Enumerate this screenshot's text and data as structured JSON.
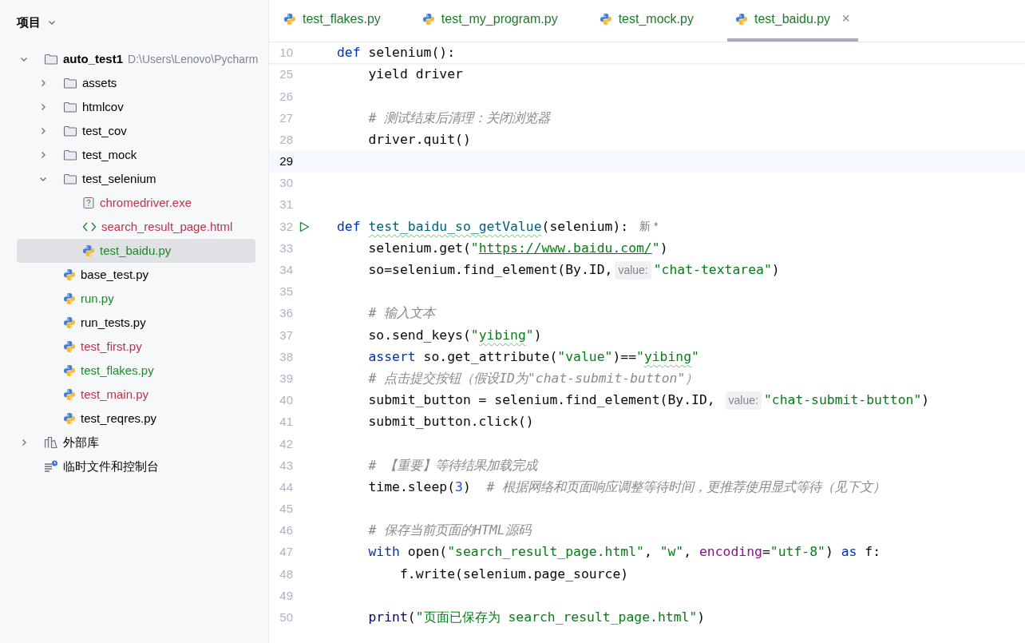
{
  "sidebar": {
    "title": "项目",
    "tree": [
      {
        "name": "auto_test1",
        "kind": "folder",
        "bold": true,
        "path": "D:\\Users\\Lenovo\\Pycharm",
        "expanded": true,
        "color": "#000000",
        "selected": false,
        "children": [
          {
            "name": "assets",
            "kind": "folder",
            "expanded": false,
            "color": "#000000",
            "selected": false
          },
          {
            "name": "htmlcov",
            "kind": "folder",
            "expanded": false,
            "color": "#000000",
            "selected": false
          },
          {
            "name": "test_cov",
            "kind": "folder",
            "expanded": false,
            "color": "#000000",
            "selected": false
          },
          {
            "name": "test_mock",
            "kind": "folder",
            "expanded": false,
            "color": "#000000",
            "selected": false
          },
          {
            "name": "test_selenium",
            "kind": "folder",
            "expanded": true,
            "color": "#000000",
            "selected": false,
            "children": [
              {
                "name": "chromedriver.exe",
                "kind": "unknown",
                "color": "#b8354c",
                "selected": false
              },
              {
                "name": "search_result_page.html",
                "kind": "html",
                "color": "#b8354c",
                "selected": false
              },
              {
                "name": "test_baidu.py",
                "kind": "python",
                "color": "#1e8a28",
                "selected": true
              }
            ]
          },
          {
            "name": "base_test.py",
            "kind": "python",
            "color": "#000000",
            "selected": false
          },
          {
            "name": "run.py",
            "kind": "python",
            "color": "#1e8a28",
            "selected": false
          },
          {
            "name": "run_tests.py",
            "kind": "python",
            "color": "#000000",
            "selected": false
          },
          {
            "name": "test_first.py",
            "kind": "python",
            "color": "#b8354c",
            "selected": false
          },
          {
            "name": "test_flakes.py",
            "kind": "python",
            "color": "#1e8a28",
            "selected": false
          },
          {
            "name": "test_main.py",
            "kind": "python",
            "color": "#b8354c",
            "selected": false
          },
          {
            "name": "test_reqres.py",
            "kind": "python",
            "color": "#000000",
            "selected": false
          }
        ]
      },
      {
        "name": "外部库",
        "kind": "library",
        "expanded": false,
        "color": "#000000",
        "selected": false
      },
      {
        "name": "临时文件和控制台",
        "kind": "scratch",
        "color": "#000000",
        "selected": false
      }
    ]
  },
  "tabs": [
    {
      "label": "test_flakes.py",
      "selected": false
    },
    {
      "label": "test_my_program.py",
      "selected": false
    },
    {
      "label": "test_mock.py",
      "selected": false
    },
    {
      "label": "test_baidu.py",
      "selected": true,
      "close": "×"
    }
  ],
  "sticky_header": {
    "number": "10",
    "tokens": [
      {
        "kind": "kw",
        "text": "def"
      },
      {
        "kind": "plain",
        "text": " selenium():"
      }
    ]
  },
  "lines": [
    {
      "number": "25",
      "kind": "code",
      "current": false,
      "tokens": [
        {
          "kind": "plain",
          "text": "    yield driver"
        }
      ]
    },
    {
      "number": "26",
      "kind": "code",
      "current": false
    },
    {
      "number": "27",
      "kind": "code",
      "current": false,
      "tokens": [
        {
          "kind": "comment",
          "text": "    # 测试结束后清理：关闭浏览器"
        }
      ]
    },
    {
      "number": "28",
      "kind": "code",
      "current": false,
      "tokens": [
        {
          "kind": "plain",
          "text": "    driver.quit()"
        }
      ]
    },
    {
      "number": "29",
      "kind": "code",
      "current": true
    },
    {
      "number": "30",
      "kind": "code",
      "current": false
    },
    {
      "number": "31",
      "kind": "code",
      "current": false
    },
    {
      "number": "32",
      "kind": "runnable",
      "current": false,
      "tokens": [
        {
          "kind": "kw",
          "text": "def "
        },
        {
          "kind": "defname",
          "text": "test_baidu_so_getValue"
        },
        {
          "kind": "plain",
          "text": "(selenium):"
        },
        {
          "kind": "author",
          "text": "新 *"
        }
      ]
    },
    {
      "number": "33",
      "kind": "code",
      "current": false,
      "tokens": [
        {
          "kind": "plain",
          "text": "    selenium.get("
        },
        {
          "kind": "str",
          "text": "\""
        },
        {
          "kind": "url",
          "text": "https://www.baidu.com/"
        },
        {
          "kind": "str",
          "text": "\""
        },
        {
          "kind": "plain",
          "text": ")"
        }
      ]
    },
    {
      "number": "34",
      "kind": "code",
      "current": false,
      "tokens": [
        {
          "kind": "plain",
          "text": "    so=selenium.find_element(By.ID,"
        },
        {
          "kind": "hint",
          "text": "value:"
        },
        {
          "kind": "str",
          "text": "\"chat-textarea\""
        },
        {
          "kind": "plain",
          "text": ")"
        }
      ]
    },
    {
      "number": "35",
      "kind": "code",
      "current": false
    },
    {
      "number": "36",
      "kind": "code",
      "current": false,
      "tokens": [
        {
          "kind": "comment",
          "text": "    # 输入文本"
        }
      ]
    },
    {
      "number": "37",
      "kind": "code",
      "current": false,
      "tokens": [
        {
          "kind": "plain",
          "text": "    so.send_keys("
        },
        {
          "kind": "str",
          "text": "\""
        },
        {
          "kind": "strtypo",
          "text": "yibing"
        },
        {
          "kind": "str",
          "text": "\""
        },
        {
          "kind": "plain",
          "text": ")"
        }
      ]
    },
    {
      "number": "38",
      "kind": "code",
      "current": false,
      "tokens": [
        {
          "kind": "kw",
          "text": "    assert"
        },
        {
          "kind": "plain",
          "text": " so.get_attribute("
        },
        {
          "kind": "str",
          "text": "\"value\""
        },
        {
          "kind": "plain",
          "text": ")=="
        },
        {
          "kind": "str",
          "text": "\""
        },
        {
          "kind": "strtypo",
          "text": "yibing"
        },
        {
          "kind": "str",
          "text": "\""
        }
      ]
    },
    {
      "number": "39",
      "kind": "code",
      "current": false,
      "tokens": [
        {
          "kind": "comment",
          "text": "    # 点击提交按钮（假设ID为\"chat-submit-button\"）"
        }
      ]
    },
    {
      "number": "40",
      "kind": "code",
      "current": false,
      "tokens": [
        {
          "kind": "plain",
          "text": "    submit_button = selenium.find_element(By.ID, "
        },
        {
          "kind": "hint",
          "text": "value:"
        },
        {
          "kind": "str",
          "text": "\"chat-submit-button\""
        },
        {
          "kind": "plain",
          "text": ")"
        }
      ]
    },
    {
      "number": "41",
      "kind": "code",
      "current": false,
      "tokens": [
        {
          "kind": "plain",
          "text": "    submit_button.click()"
        }
      ]
    },
    {
      "number": "42",
      "kind": "code",
      "current": false
    },
    {
      "number": "43",
      "kind": "code",
      "current": false,
      "tokens": [
        {
          "kind": "comment",
          "text": "    # 【重要】等待结果加载完成"
        }
      ]
    },
    {
      "number": "44",
      "kind": "code",
      "current": false,
      "tokens": [
        {
          "kind": "plain",
          "text": "    time.sleep("
        },
        {
          "kind": "num",
          "text": "3"
        },
        {
          "kind": "plain",
          "text": ")  "
        },
        {
          "kind": "comment",
          "text": "# 根据网络和页面响应调整等待时间，更推荐使用显式等待（见下文）"
        }
      ]
    },
    {
      "number": "45",
      "kind": "code",
      "current": false
    },
    {
      "number": "46",
      "kind": "code",
      "current": false,
      "tokens": [
        {
          "kind": "comment",
          "text": "    # 保存当前页面的HTML源码"
        }
      ]
    },
    {
      "number": "47",
      "kind": "code",
      "current": false,
      "tokens": [
        {
          "kind": "kw",
          "text": "    with"
        },
        {
          "kind": "plain",
          "text": " open("
        },
        {
          "kind": "str",
          "text": "\"search_result_page.html\""
        },
        {
          "kind": "plain",
          "text": ", "
        },
        {
          "kind": "str",
          "text": "\"w\""
        },
        {
          "kind": "plain",
          "text": ", "
        },
        {
          "kind": "param",
          "text": "encoding"
        },
        {
          "kind": "plain",
          "text": "="
        },
        {
          "kind": "str",
          "text": "\"utf-8\""
        },
        {
          "kind": "plain",
          "text": ") "
        },
        {
          "kind": "kw",
          "text": "as"
        },
        {
          "kind": "plain",
          "text": " f:"
        }
      ]
    },
    {
      "number": "48",
      "kind": "code",
      "current": false,
      "tokens": [
        {
          "kind": "plain",
          "text": "        f.write(selenium.page_source)"
        }
      ]
    },
    {
      "number": "49",
      "kind": "code",
      "current": false
    },
    {
      "number": "50",
      "kind": "code",
      "current": false,
      "tokens": [
        {
          "kind": "builtin",
          "text": "    print"
        },
        {
          "kind": "plain",
          "text": "("
        },
        {
          "kind": "str",
          "text": "\"页面已保存为 search_result_page.html\""
        },
        {
          "kind": "plain",
          "text": ")"
        }
      ]
    }
  ]
}
